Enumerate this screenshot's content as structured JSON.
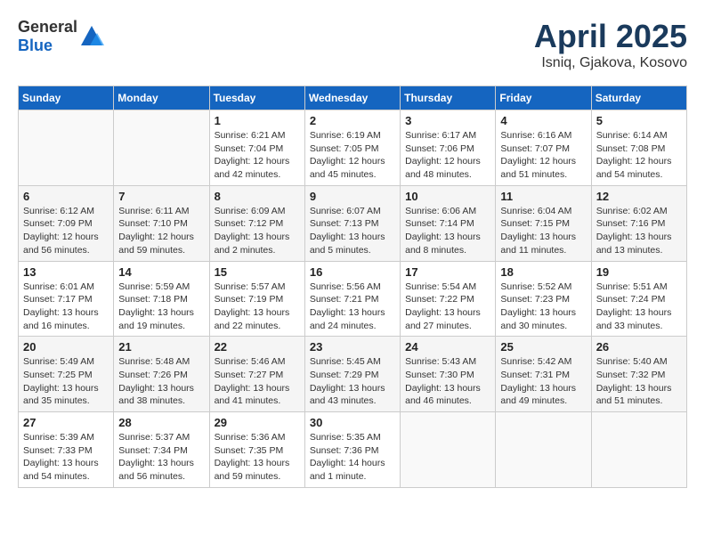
{
  "header": {
    "logo_general": "General",
    "logo_blue": "Blue",
    "month_year": "April 2025",
    "location": "Isniq, Gjakova, Kosovo"
  },
  "weekdays": [
    "Sunday",
    "Monday",
    "Tuesday",
    "Wednesday",
    "Thursday",
    "Friday",
    "Saturday"
  ],
  "weeks": [
    [
      {
        "day": "",
        "info": ""
      },
      {
        "day": "",
        "info": ""
      },
      {
        "day": "1",
        "info": "Sunrise: 6:21 AM\nSunset: 7:04 PM\nDaylight: 12 hours and 42 minutes."
      },
      {
        "day": "2",
        "info": "Sunrise: 6:19 AM\nSunset: 7:05 PM\nDaylight: 12 hours and 45 minutes."
      },
      {
        "day": "3",
        "info": "Sunrise: 6:17 AM\nSunset: 7:06 PM\nDaylight: 12 hours and 48 minutes."
      },
      {
        "day": "4",
        "info": "Sunrise: 6:16 AM\nSunset: 7:07 PM\nDaylight: 12 hours and 51 minutes."
      },
      {
        "day": "5",
        "info": "Sunrise: 6:14 AM\nSunset: 7:08 PM\nDaylight: 12 hours and 54 minutes."
      }
    ],
    [
      {
        "day": "6",
        "info": "Sunrise: 6:12 AM\nSunset: 7:09 PM\nDaylight: 12 hours and 56 minutes."
      },
      {
        "day": "7",
        "info": "Sunrise: 6:11 AM\nSunset: 7:10 PM\nDaylight: 12 hours and 59 minutes."
      },
      {
        "day": "8",
        "info": "Sunrise: 6:09 AM\nSunset: 7:12 PM\nDaylight: 13 hours and 2 minutes."
      },
      {
        "day": "9",
        "info": "Sunrise: 6:07 AM\nSunset: 7:13 PM\nDaylight: 13 hours and 5 minutes."
      },
      {
        "day": "10",
        "info": "Sunrise: 6:06 AM\nSunset: 7:14 PM\nDaylight: 13 hours and 8 minutes."
      },
      {
        "day": "11",
        "info": "Sunrise: 6:04 AM\nSunset: 7:15 PM\nDaylight: 13 hours and 11 minutes."
      },
      {
        "day": "12",
        "info": "Sunrise: 6:02 AM\nSunset: 7:16 PM\nDaylight: 13 hours and 13 minutes."
      }
    ],
    [
      {
        "day": "13",
        "info": "Sunrise: 6:01 AM\nSunset: 7:17 PM\nDaylight: 13 hours and 16 minutes."
      },
      {
        "day": "14",
        "info": "Sunrise: 5:59 AM\nSunset: 7:18 PM\nDaylight: 13 hours and 19 minutes."
      },
      {
        "day": "15",
        "info": "Sunrise: 5:57 AM\nSunset: 7:19 PM\nDaylight: 13 hours and 22 minutes."
      },
      {
        "day": "16",
        "info": "Sunrise: 5:56 AM\nSunset: 7:21 PM\nDaylight: 13 hours and 24 minutes."
      },
      {
        "day": "17",
        "info": "Sunrise: 5:54 AM\nSunset: 7:22 PM\nDaylight: 13 hours and 27 minutes."
      },
      {
        "day": "18",
        "info": "Sunrise: 5:52 AM\nSunset: 7:23 PM\nDaylight: 13 hours and 30 minutes."
      },
      {
        "day": "19",
        "info": "Sunrise: 5:51 AM\nSunset: 7:24 PM\nDaylight: 13 hours and 33 minutes."
      }
    ],
    [
      {
        "day": "20",
        "info": "Sunrise: 5:49 AM\nSunset: 7:25 PM\nDaylight: 13 hours and 35 minutes."
      },
      {
        "day": "21",
        "info": "Sunrise: 5:48 AM\nSunset: 7:26 PM\nDaylight: 13 hours and 38 minutes."
      },
      {
        "day": "22",
        "info": "Sunrise: 5:46 AM\nSunset: 7:27 PM\nDaylight: 13 hours and 41 minutes."
      },
      {
        "day": "23",
        "info": "Sunrise: 5:45 AM\nSunset: 7:29 PM\nDaylight: 13 hours and 43 minutes."
      },
      {
        "day": "24",
        "info": "Sunrise: 5:43 AM\nSunset: 7:30 PM\nDaylight: 13 hours and 46 minutes."
      },
      {
        "day": "25",
        "info": "Sunrise: 5:42 AM\nSunset: 7:31 PM\nDaylight: 13 hours and 49 minutes."
      },
      {
        "day": "26",
        "info": "Sunrise: 5:40 AM\nSunset: 7:32 PM\nDaylight: 13 hours and 51 minutes."
      }
    ],
    [
      {
        "day": "27",
        "info": "Sunrise: 5:39 AM\nSunset: 7:33 PM\nDaylight: 13 hours and 54 minutes."
      },
      {
        "day": "28",
        "info": "Sunrise: 5:37 AM\nSunset: 7:34 PM\nDaylight: 13 hours and 56 minutes."
      },
      {
        "day": "29",
        "info": "Sunrise: 5:36 AM\nSunset: 7:35 PM\nDaylight: 13 hours and 59 minutes."
      },
      {
        "day": "30",
        "info": "Sunrise: 5:35 AM\nSunset: 7:36 PM\nDaylight: 14 hours and 1 minute."
      },
      {
        "day": "",
        "info": ""
      },
      {
        "day": "",
        "info": ""
      },
      {
        "day": "",
        "info": ""
      }
    ]
  ]
}
